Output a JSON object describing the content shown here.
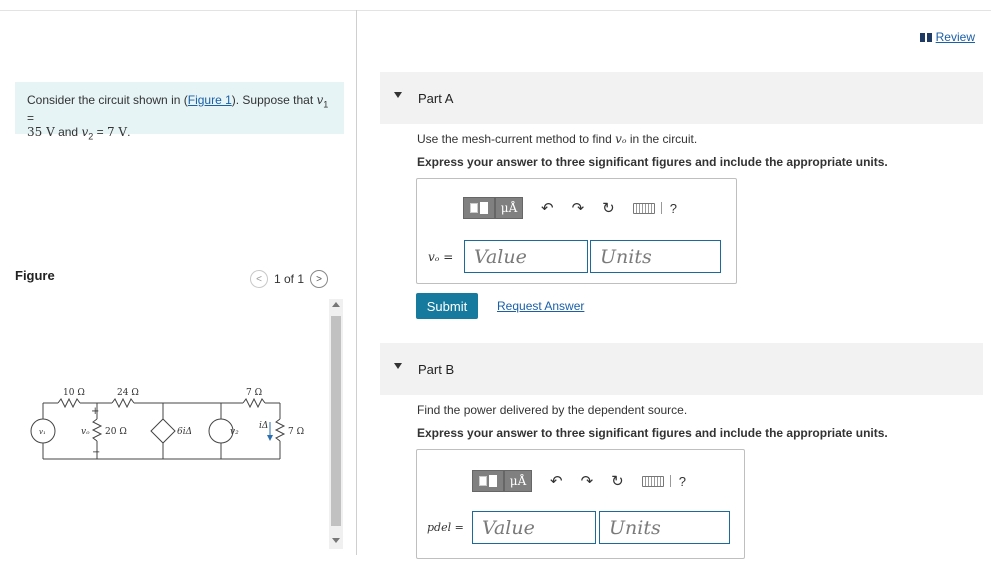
{
  "review": {
    "label": "Review"
  },
  "problem": {
    "prefix": "Consider the circuit shown in (",
    "link": "Figure 1",
    "mid": "). Suppose that ",
    "v1_sym": "v",
    "v1_sub": "1",
    "eq1": " = ",
    "line2_val1": "35 V",
    "and": " and ",
    "v2_sym": "v",
    "v2_sub": "2",
    "eq2": " = ",
    "val2": "7 V",
    "end": "."
  },
  "figure": {
    "title": "Figure",
    "pager": "1 of 1",
    "prev": "<",
    "next": ">",
    "labels": {
      "r10": "10 Ω",
      "r24": "24 Ω",
      "r7top": "7 Ω",
      "r20": "20 Ω",
      "r7": "7 Ω",
      "v1": "v₁",
      "vo": "vₒ",
      "dep": "6iΔ",
      "v2": "v₂",
      "idelta": "iΔ",
      "plus": "+",
      "minus": "−"
    }
  },
  "partA": {
    "title": "Part A",
    "instruction_prefix": "Use the mesh-current method to find ",
    "instruction_var": "vₒ",
    "instruction_suffix": " in the circuit.",
    "bold": "Express your answer to three significant figures and include the appropriate units.",
    "label": "vₒ =",
    "value_placeholder": "Value",
    "units_placeholder": "Units",
    "mu": "μÅ",
    "help": "?",
    "submit": "Submit",
    "request": "Request Answer"
  },
  "partB": {
    "title": "Part B",
    "instruction": "Find the power delivered by the dependent source.",
    "bold": "Express your answer to three significant figures and include the appropriate units.",
    "label": "pdel =",
    "value_placeholder": "Value",
    "units_placeholder": "Units",
    "mu": "μÅ",
    "help": "?"
  },
  "icons": [
    "bookmark-icon",
    "undo-icon",
    "redo-icon",
    "reset-icon",
    "keyboard-icon",
    "help-icon",
    "chevron-left-icon",
    "chevron-right-icon",
    "collapse-triangle-icon"
  ]
}
